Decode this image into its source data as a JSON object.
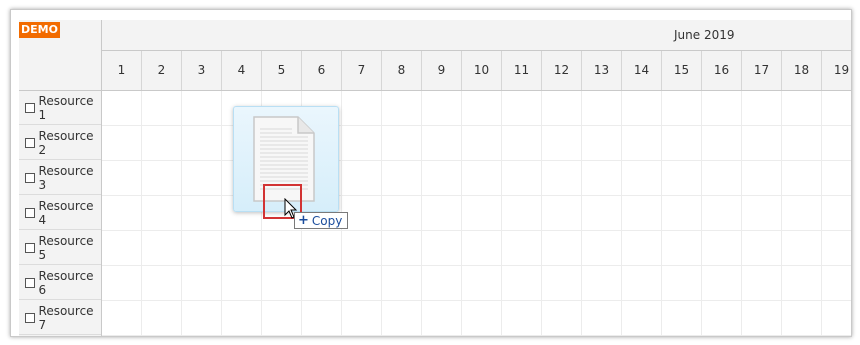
{
  "demo_label": "DEMO",
  "month_label": "June 2019",
  "days": [
    "1",
    "2",
    "3",
    "4",
    "5",
    "6",
    "7",
    "8",
    "9",
    "10",
    "11",
    "12",
    "13",
    "14",
    "15",
    "16",
    "17",
    "18",
    "19"
  ],
  "resources": [
    "Resource 1",
    "Resource 2",
    "Resource 3",
    "Resource 4",
    "Resource 5",
    "Resource 6",
    "Resource 7"
  ],
  "drag_tooltip": {
    "label": "Copy",
    "icon": "plus-icon"
  },
  "colors": {
    "demo_badge": "#f26b00",
    "drop_target_border": "#d23333",
    "ghost_background": "#dff1fb",
    "tooltip_text": "#1a4c9c"
  }
}
